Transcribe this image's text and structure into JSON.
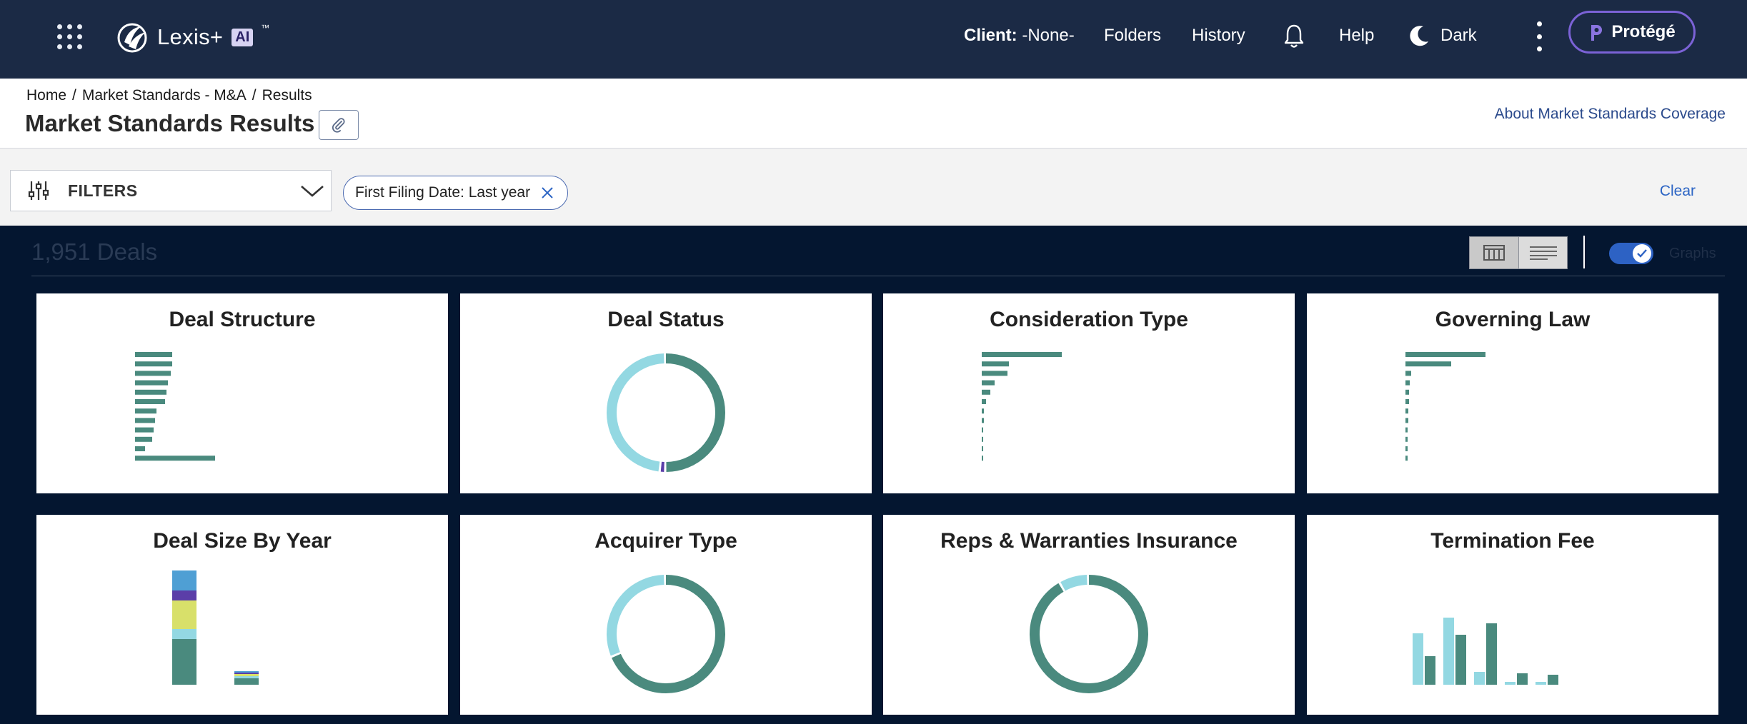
{
  "nav": {
    "brand": "Lexis+",
    "brand_ai": "AI",
    "brand_tm": "™",
    "client_label": "Client:",
    "client_value": " -None-",
    "folders": "Folders",
    "history": "History",
    "help": "Help",
    "dark": "Dark",
    "protege": "Protégé"
  },
  "breadcrumb": {
    "home": "Home",
    "sep1": "/",
    "market": "Market Standards - M&A",
    "sep2": "/",
    "results": "Results"
  },
  "header": {
    "title": "Market Standards Results",
    "about_link": "About Market Standards Coverage"
  },
  "filters": {
    "label": "FILTERS",
    "chip": "First Filing Date: Last year",
    "clear": "Clear"
  },
  "results": {
    "count": "1,951 Deals",
    "graphs_label": "Graphs"
  },
  "colors": {
    "primary": "#4a8a7e",
    "light": "#93d8e2",
    "purple": "#5b3ea8",
    "yellow": "#d8e06a",
    "blue": "#4f9fd4"
  },
  "cards": [
    {
      "id": "deal-structure",
      "title": "Deal Structure",
      "type": "hbar"
    },
    {
      "id": "deal-status",
      "title": "Deal Status",
      "type": "donut"
    },
    {
      "id": "consideration-type",
      "title": "Consideration Type",
      "type": "hbar"
    },
    {
      "id": "governing-law",
      "title": "Governing Law",
      "type": "hbar"
    },
    {
      "id": "deal-size-by-year",
      "title": "Deal Size By Year",
      "type": "stacked-bar"
    },
    {
      "id": "acquirer-type",
      "title": "Acquirer Type",
      "type": "donut"
    },
    {
      "id": "reps-warranties-insurance",
      "title": "Reps & Warranties Insurance",
      "type": "donut"
    },
    {
      "id": "termination-fee",
      "title": "Termination Fee",
      "type": "grouped-bar"
    }
  ],
  "chart_data": [
    {
      "type": "bar",
      "orientation": "horizontal",
      "card": "Deal Structure",
      "values": [
        52,
        52,
        50,
        46,
        44,
        42,
        30,
        28,
        26,
        24,
        14,
        112
      ]
    },
    {
      "type": "pie",
      "donut": true,
      "card": "Deal Status",
      "values": [
        50.5,
        1.5,
        48
      ],
      "colors": [
        "#4a8a7e",
        "#5b3ea8",
        "#93d8e2"
      ]
    },
    {
      "type": "bar",
      "orientation": "horizontal",
      "card": "Consideration Type",
      "values": [
        112,
        38,
        36,
        18,
        12,
        6,
        3,
        3,
        2,
        2,
        2,
        2
      ]
    },
    {
      "type": "bar",
      "orientation": "horizontal",
      "card": "Governing Law",
      "values": [
        112,
        64,
        8,
        6,
        5,
        5,
        4,
        4,
        3,
        3,
        3,
        3
      ]
    },
    {
      "type": "bar",
      "stacked": true,
      "card": "Deal Size By Year",
      "series": [
        {
          "values": [
            64,
            9
          ],
          "color": "#4a8a7e"
        },
        {
          "values": [
            14,
            3
          ],
          "color": "#93d8e2"
        },
        {
          "values": [
            40,
            3
          ],
          "color": "#d8e06a"
        },
        {
          "values": [
            14,
            2
          ],
          "color": "#5b3ea8"
        },
        {
          "values": [
            28,
            2
          ],
          "color": "#4f9fd4"
        }
      ]
    },
    {
      "type": "pie",
      "donut": true,
      "card": "Acquirer Type",
      "values": [
        69,
        31
      ],
      "colors": [
        "#4a8a7e",
        "#93d8e2"
      ]
    },
    {
      "type": "pie",
      "donut": true,
      "card": "Reps & Warranties Insurance",
      "values": [
        92,
        8
      ],
      "colors": [
        "#4a8a7e",
        "#93d8e2"
      ]
    },
    {
      "type": "bar",
      "grouped": true,
      "card": "Termination Fee",
      "series": [
        {
          "values": [
            72,
            94,
            18,
            4,
            4
          ],
          "color": "#93d8e2"
        },
        {
          "values": [
            40,
            70,
            86,
            16,
            14
          ],
          "color": "#4a8a7e"
        }
      ]
    }
  ]
}
